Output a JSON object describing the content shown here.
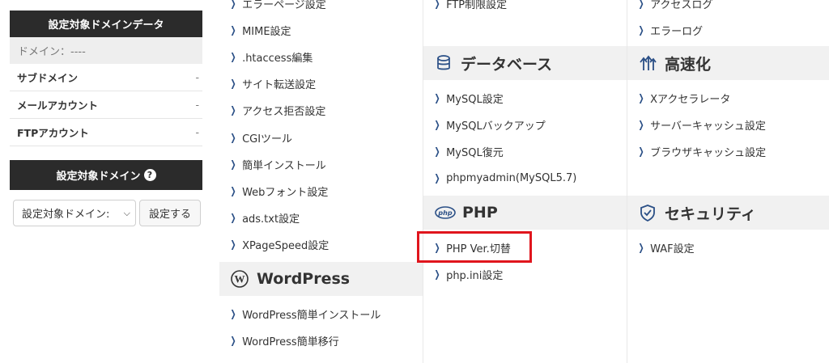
{
  "sidebar": {
    "target_domain_data_title": "設定対象ドメインデータ",
    "domain_row": "ドメイン：----",
    "info_rows": [
      {
        "label": "サブドメイン",
        "value": "-"
      },
      {
        "label": "メールアカウント",
        "value": "-"
      },
      {
        "label": "FTPアカウント",
        "value": "-"
      }
    ],
    "target_domain_title": "設定対象ドメイン",
    "help_glyph": "?",
    "select_value": "設定対象ドメイン:",
    "set_button": "設定する"
  },
  "col1": {
    "items_top": [
      "エラーページ設定",
      "MIME設定",
      ".htaccess編集",
      "サイト転送設定",
      "アクセス拒否設定",
      "CGIツール",
      "簡単インストール",
      "Webフォント設定",
      "ads.txt設定",
      "XPageSpeed設定"
    ],
    "wordpress_title": "WordPress",
    "items_wp": [
      "WordPress簡単インストール",
      "WordPress簡単移行"
    ]
  },
  "col2": {
    "items_top": [
      "FTP制限設定"
    ],
    "database_title": "データベース",
    "items_db": [
      "MySQL設定",
      "MySQLバックアップ",
      "MySQL復元",
      "phpmyadmin(MySQL5.7)"
    ],
    "php_title": "PHP",
    "php_badge": "php",
    "items_php": [
      "PHP Ver.切替",
      "php.ini設定"
    ]
  },
  "col3": {
    "items_top": [
      "アクセスログ",
      "エラーログ"
    ],
    "speed_title": "高速化",
    "items_speed": [
      "Xアクセラレータ",
      "サーバーキャッシュ設定",
      "ブラウザキャッシュ設定"
    ],
    "security_title": "セキュリティ",
    "items_security": [
      "WAF設定"
    ]
  },
  "colors": {
    "dark": "#2b2b2b",
    "link_chevron": "#2a4f86",
    "highlight": "#e0151d",
    "section_bg": "#f1f1f1",
    "icon_blue": "#2a4f86"
  }
}
